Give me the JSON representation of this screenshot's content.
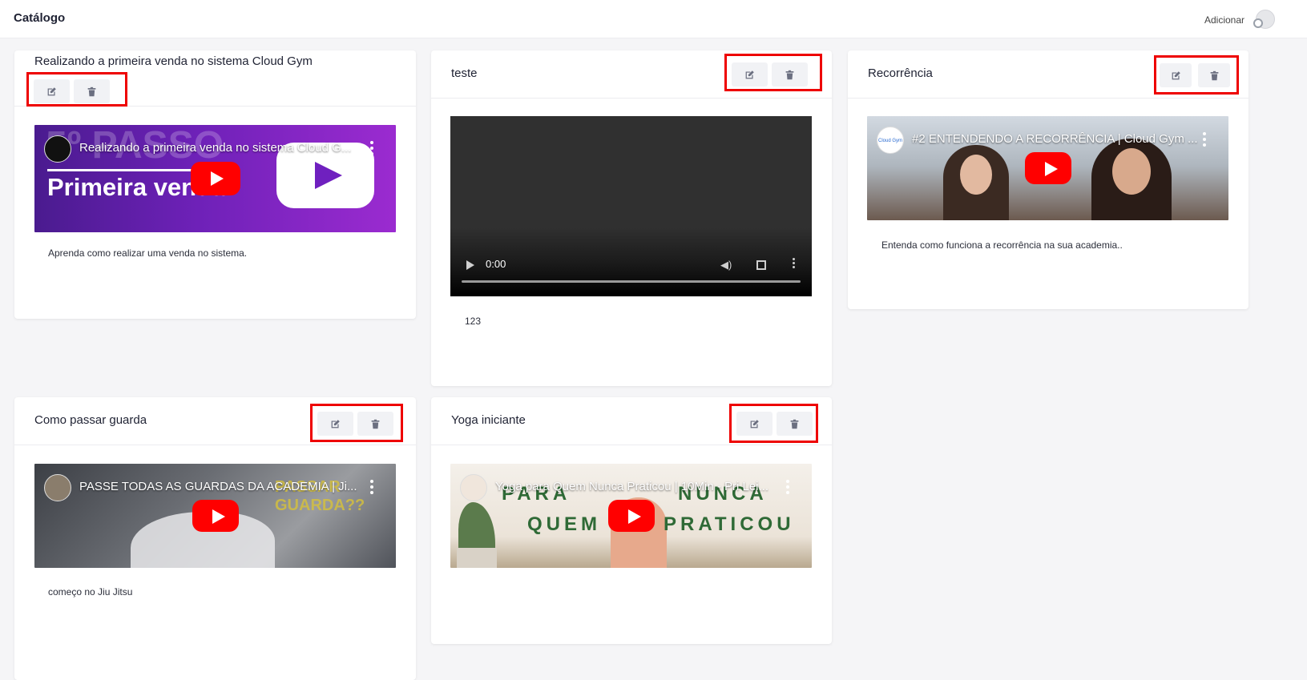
{
  "header": {
    "title": "Catálogo",
    "add_label": "Adicionar"
  },
  "colors": {
    "highlight_border": "#ee0000",
    "button_bg": "#f1f2f5",
    "icon_color": "#6b6f80",
    "youtube_red": "#ff0000"
  },
  "cards": [
    {
      "title": "Realizando a primeira venda no sistema Cloud Gym",
      "video_title": "Realizando a primeira venda no sistema Cloud G...",
      "thumb_text_1": "5º PASSO",
      "thumb_text_2": "Primeira venda",
      "description": "Aprenda como realizar uma venda no sistema."
    },
    {
      "title": "teste",
      "player_time": "0:00",
      "description": "123"
    },
    {
      "title": "Recorrência",
      "video_title": "#2 ENTENDENDO A RECORRÊNCIA | Cloud Gym ...",
      "channel_name": "Cloud Gym",
      "description": "Entenda como funciona a recorrência na sua academia.."
    },
    {
      "title": "Como passar guarda",
      "video_title": "PASSE TODAS AS GUARDAS DA ACADEMIA | Ji...",
      "thumb_text": "PASSAR GUARDA??",
      "description": "começo no Jiu Jitsu"
    },
    {
      "title": "Yoga iniciante",
      "video_title": "Yoga para Quem Nunca Praticou | 10Min - Pri Lei...",
      "thumb_word_1": "PARA",
      "thumb_word_2": "NUNCA",
      "thumb_word_3": "QUEM",
      "thumb_word_4": "PRATICOU"
    }
  ]
}
